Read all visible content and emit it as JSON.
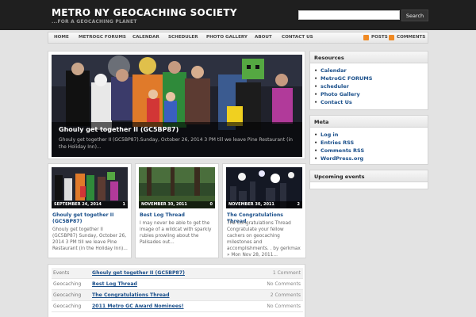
{
  "site": {
    "title": "METRO NY GEOCACHING SOCIETY",
    "tagline": "...FOR A GEOCACHING PLANET"
  },
  "search": {
    "button_label": "Search",
    "value": ""
  },
  "nav": {
    "items": [
      "HOME",
      "METROGC FORUMS",
      "CALENDAR",
      "SCHEDULER",
      "PHOTO GALLERY",
      "ABOUT",
      "CONTACT US"
    ],
    "posts_label": "POSTS",
    "comments_label": "COMMENTS"
  },
  "feature": {
    "title": "Ghouly get together II (GC5BP87)",
    "text": "Ghouly get together II (GC5BP87).Sunday, October 26, 2014 3 PM till we leave Pine Restaurant (in the Holiday Inn)..."
  },
  "cards": [
    {
      "date": "SEPTEMBER 24, 2014",
      "count": "1",
      "title": "Ghouly get together II (GC5BP87)",
      "excerpt": "Ghouly get together II (GC5BP87) Sunday, October 26, 2014 3 PM till we leave Pine Restaurant (in the Holiday Inn)..."
    },
    {
      "date": "NOVEMBER 30, 2011",
      "count": "0",
      "title": "Best Log Thread",
      "excerpt": "I may never be able to get the image of a wildcat with sparkly rubies prowling about the Palisades out..."
    },
    {
      "date": "NOVEMBER 30, 2011",
      "count": "2",
      "title": "The Congratulations Thread",
      "excerpt": "The Congratulations Thread Congratulate your fellow cachers on geocaching milestones and accomplishments. . by gerkmax » Mon Nov 28, 2011..."
    }
  ],
  "list": [
    {
      "category": "Events",
      "title": "Ghouly get together II (GC5BP87)",
      "comments": "1 Comment"
    },
    {
      "category": "Geocaching",
      "title": "Best Log Thread",
      "comments": "No Comments"
    },
    {
      "category": "Geocaching",
      "title": "The Congratulations Thread",
      "comments": "2 Comments"
    },
    {
      "category": "Geocaching",
      "title": "2011 Metro GC Award Nominees!",
      "comments": "No Comments"
    }
  ],
  "sidebar": {
    "resources": {
      "title": "Resources",
      "items": [
        "Calendar",
        "MetroGC FORUMS",
        "scheduler",
        "Photo Gallery",
        "Contact Us"
      ]
    },
    "meta": {
      "title": "Meta",
      "items": [
        "Log in",
        "Entries RSS",
        "Comments RSS",
        "WordPress.org"
      ]
    },
    "upcoming": {
      "title": "Upcoming events"
    }
  },
  "colors": {
    "header_bg": "#1f1f1f",
    "link": "#1a4f8a",
    "rss": "#f08a24",
    "page_bg": "#e3e3e3"
  }
}
